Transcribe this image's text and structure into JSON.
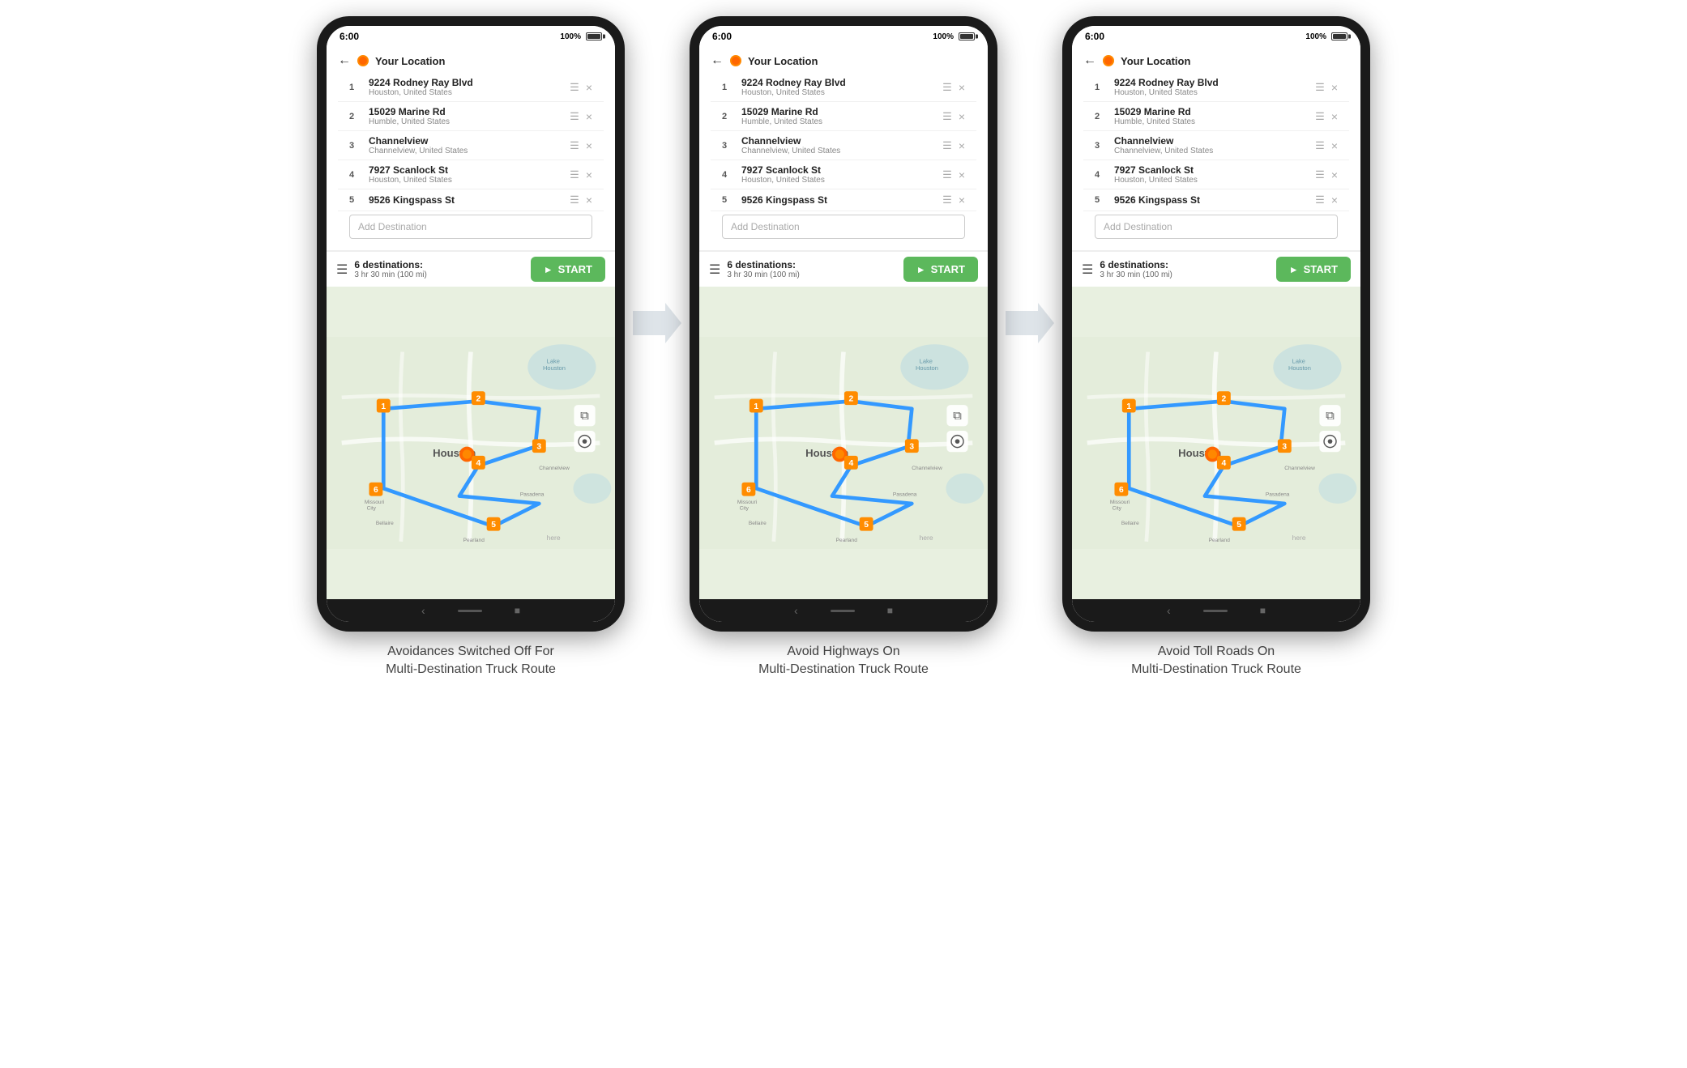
{
  "phones": [
    {
      "id": "phone1",
      "status": {
        "time": "6:00",
        "battery": "100%"
      },
      "caption": "Avoidances Switched Off For\nMulti-Destination Truck Route",
      "destinations": [
        {
          "num": "1",
          "name": "9224 Rodney Ray Blvd",
          "sub": "Houston, United States"
        },
        {
          "num": "2",
          "name": "15029 Marine Rd",
          "sub": "Humble, United States"
        },
        {
          "num": "3",
          "name": "Channelview",
          "sub": "Channelview, United States"
        },
        {
          "num": "4",
          "name": "7927 Scanlock St",
          "sub": "Houston, United States"
        },
        {
          "num": "5",
          "name": "9526 Kingspass St",
          "sub": ""
        }
      ],
      "add_dest_placeholder": "Add Destination",
      "dest_count": "6 destinations:",
      "dest_time": "3 hr 30 min (100 mi)",
      "start_label": "START"
    },
    {
      "id": "phone2",
      "status": {
        "time": "6:00",
        "battery": "100%"
      },
      "caption": "Avoid Highways On\nMulti-Destination Truck Route",
      "destinations": [
        {
          "num": "1",
          "name": "9224 Rodney Ray Blvd",
          "sub": "Houston, United States"
        },
        {
          "num": "2",
          "name": "15029 Marine Rd",
          "sub": "Humble, United States"
        },
        {
          "num": "3",
          "name": "Channelview",
          "sub": "Channelview, United States"
        },
        {
          "num": "4",
          "name": "7927 Scanlock St",
          "sub": "Houston, United States"
        },
        {
          "num": "5",
          "name": "9526 Kingspass St",
          "sub": ""
        }
      ],
      "add_dest_placeholder": "Add Destination",
      "dest_count": "6 destinations:",
      "dest_time": "3 hr 30 min (100 mi)",
      "start_label": "START"
    },
    {
      "id": "phone3",
      "status": {
        "time": "6:00",
        "battery": "100%"
      },
      "caption": "Avoid Toll Roads On\nMulti-Destination Truck Route",
      "destinations": [
        {
          "num": "1",
          "name": "9224 Rodney Ray Blvd",
          "sub": "Houston, United States"
        },
        {
          "num": "2",
          "name": "15029 Marine Rd",
          "sub": "Humble, United States"
        },
        {
          "num": "3",
          "name": "Channelview",
          "sub": "Channelview, United States"
        },
        {
          "num": "4",
          "name": "7927 Scanlock St",
          "sub": "Houston, United States"
        },
        {
          "num": "5",
          "name": "9526 Kingspass St",
          "sub": ""
        }
      ],
      "add_dest_placeholder": "Add Destination",
      "dest_count": "6 destinations:",
      "dest_time": "3 hr 30 min (100 mi)",
      "start_label": "START"
    }
  ],
  "arrow": "→",
  "your_location": "Your Location"
}
